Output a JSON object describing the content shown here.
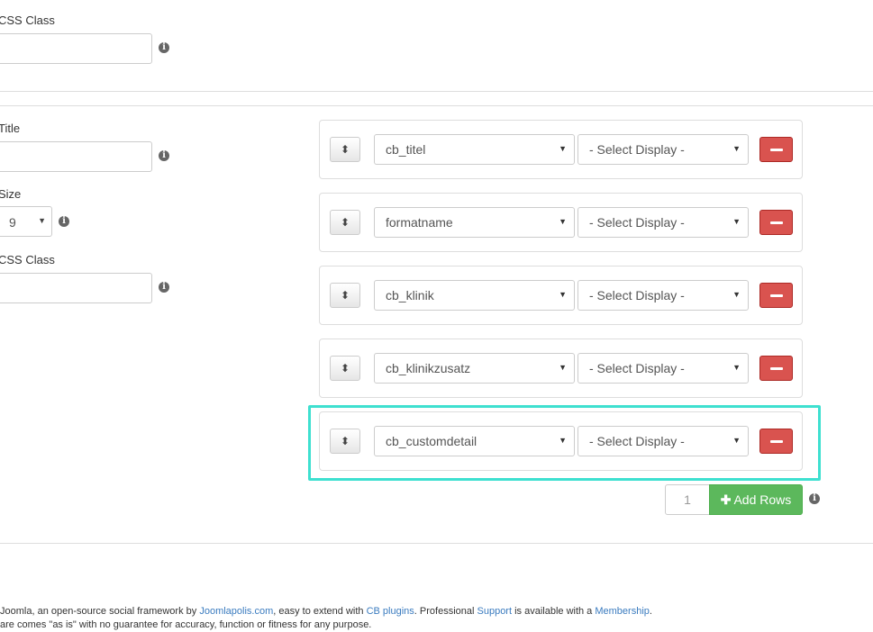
{
  "top": {
    "css_class_label": "CSS Class"
  },
  "left": {
    "title_label": "Title",
    "size_label": "Size",
    "size_value": "9",
    "css_class_label": "CSS Class"
  },
  "rows": [
    {
      "field": "cb_titel",
      "display": "- Select Display -"
    },
    {
      "field": "formatname",
      "display": "- Select Display -"
    },
    {
      "field": "cb_klinik",
      "display": "- Select Display -"
    },
    {
      "field": "cb_klinikzusatz",
      "display": "- Select Display -"
    },
    {
      "field": "cb_customdetail",
      "display": "- Select Display -"
    }
  ],
  "add": {
    "count": "1",
    "label": "Add Rows"
  },
  "footer": {
    "line1_a": "Joomla, an open-source social framework by ",
    "line1_link1": "Joomlapolis.com",
    "line1_b": ", easy to extend with ",
    "line1_link2": "CB plugins",
    "line1_c": ". Professional ",
    "line1_link3": "Support",
    "line1_d": " is available with a ",
    "line1_link4": "Membership",
    "line1_e": ".",
    "line2": "are comes \"as is\" with no guarantee for accuracy, function or fitness for any purpose."
  },
  "colors": {
    "highlight": "#3ee0d0",
    "danger": "#d9534f",
    "success": "#5cb85c",
    "link": "#3a7bbf"
  }
}
